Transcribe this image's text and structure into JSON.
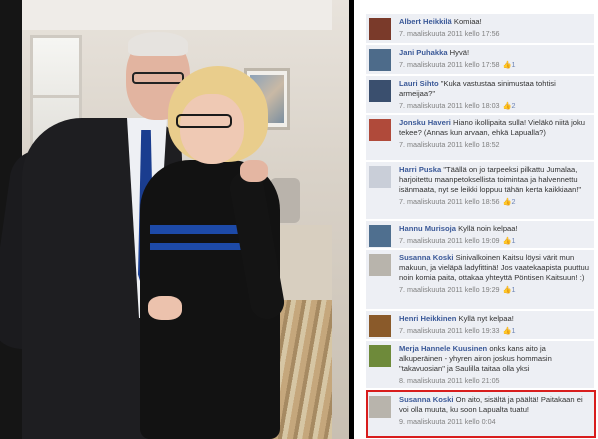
{
  "comments": [
    {
      "author": "Albert Heikkilä",
      "text": "Komiaa!",
      "time": "7. maaliskuuta 2011 kello 17:56",
      "likes": "",
      "avatar_color": "#7a3a2a"
    },
    {
      "author": "Jani Puhakka",
      "text": "Hyvä!",
      "time": "7. maaliskuuta 2011 kello 17:58",
      "likes": "1",
      "avatar_color": "#4d6b8a"
    },
    {
      "author": "Lauri Sihto",
      "text": "\"Kuka vastustaa sinimustaa tohtisi armeijaa?\"",
      "time": "7. maaliskuuta 2011 kello 18:03",
      "likes": "2",
      "avatar_color": "#3a4f6e"
    },
    {
      "author": "Jonsku Haveri",
      "text": "Hiano ikollipaita sulla! Vieläkö niitä joku tekee? (Annas kun arvaan, ehkä Lapualla?)",
      "time": "7. maaliskuuta 2011 kello 18:52",
      "likes": "",
      "avatar_color": "#b04a3a"
    },
    {
      "author": "Harri Puska",
      "text": "\"Täällä on jo tarpeeksi pilkattu Jumalaa, harjoitettu maanpetoksellista toimintaa ja halvennettu isänmaata, nyt se leikki loppuu tähän kerta kaikkiaan!\"",
      "time": "7. maaliskuuta 2011 kello 18:56",
      "likes": "2",
      "avatar_color": "#c9ced8"
    },
    {
      "author": "Hannu Murisoja",
      "text": "Kyllä noin kelpaa!",
      "time": "7. maaliskuuta 2011 kello 19:09",
      "likes": "1",
      "avatar_color": "#4f6f8f"
    },
    {
      "author": "Susanna Koski",
      "text": "Sinivalkoinen Kaitsu löysi värit mun makuun, ja vieläpä ladyfittinä! Jos vaatekaapista puuttuu noin komia paita, ottakaa yhteyttä Pöntisen Kaitsuun!",
      "emoticon": ":)",
      "time": "7. maaliskuuta 2011 kello 19:29",
      "likes": "1",
      "avatar_color": "#b8b4ac"
    },
    {
      "author": "Henri Heikkinen",
      "text": "Kyllä nyt kelpaa!",
      "time": "7. maaliskuuta 2011 kello 19:33",
      "likes": "1",
      "avatar_color": "#8a5a2a"
    },
    {
      "author": "Merja Hannele Kuusinen",
      "text": "onks kans aito ja alkuperäinen - yhyren airon joskus hommasin \"takavuosian\" ja Saulilla taitaa olla yksi",
      "time": "8. maaliskuuta 2011 kello 21:05",
      "likes": "",
      "avatar_color": "#6e8a3a"
    },
    {
      "author": "Susanna Koski",
      "text": "On aito, sisältä ja päältä! Paitakaan ei voi olla muuta, ku soon Lapualta tuatu!",
      "time": "9. maaliskuuta 2011 kello 0:04",
      "likes": "",
      "avatar_color": "#b8b4ac"
    }
  ],
  "colors": {
    "accent": "#3b5998",
    "highlight": "#d81d1d",
    "comment_bg": "#edeff4"
  },
  "icons": {
    "like": "thumbs-up-icon"
  }
}
